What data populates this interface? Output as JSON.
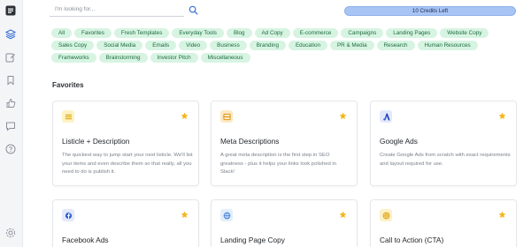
{
  "search": {
    "placeholder": "I'm looking for..."
  },
  "credits": {
    "label": "10 Credits Left"
  },
  "categories": [
    "All",
    "Favorites",
    "Fresh Templates",
    "Everyday Tools",
    "Blog",
    "Ad Copy",
    "E-commerce",
    "Campaigns",
    "Landing Pages",
    "Website Copy",
    "Sales Copy",
    "Social Media",
    "Emails",
    "Video",
    "Business",
    "Branding",
    "Education",
    "PR & Media",
    "Research",
    "Human Resources",
    "Frameworks",
    "Brainstorming",
    "Investor Pitch",
    "Miscellaneous"
  ],
  "favorites": {
    "title": "Favorites",
    "cards": [
      {
        "icon": "list-icon",
        "title": "Listicle + Description",
        "desc": "The quickest way to jump start your next listicle. We'll list your items and even describe them so that really, all you need to do is publish it."
      },
      {
        "icon": "meta-icon",
        "title": "Meta Descriptions",
        "desc": "A great meta description is the first step in SEO greatness - plus it helps your links look polished in Slack!"
      },
      {
        "icon": "google-ads-icon",
        "title": "Google Ads",
        "desc": "Create Google Ads from scratch with exact requirements and layout required for use."
      },
      {
        "icon": "facebook-icon",
        "title": "Facebook Ads",
        "desc": ""
      },
      {
        "icon": "globe-icon",
        "title": "Landing Page Copy",
        "desc": ""
      },
      {
        "icon": "target-icon",
        "title": "Call to Action (CTA)",
        "desc": ""
      }
    ]
  },
  "sidebar": {
    "items": [
      "logo-icon",
      "layers-icon",
      "edit-icon",
      "bookmark-icon",
      "thumbs-up-icon",
      "chat-icon",
      "help-icon",
      "settings-icon"
    ]
  },
  "colors": {
    "pill_bg": "#d7f4e2",
    "pill_text": "#1c6b3f",
    "accent_blue": "#3b6fd8",
    "star": "#f2b619",
    "credits_bg": "#a7c4f5"
  }
}
